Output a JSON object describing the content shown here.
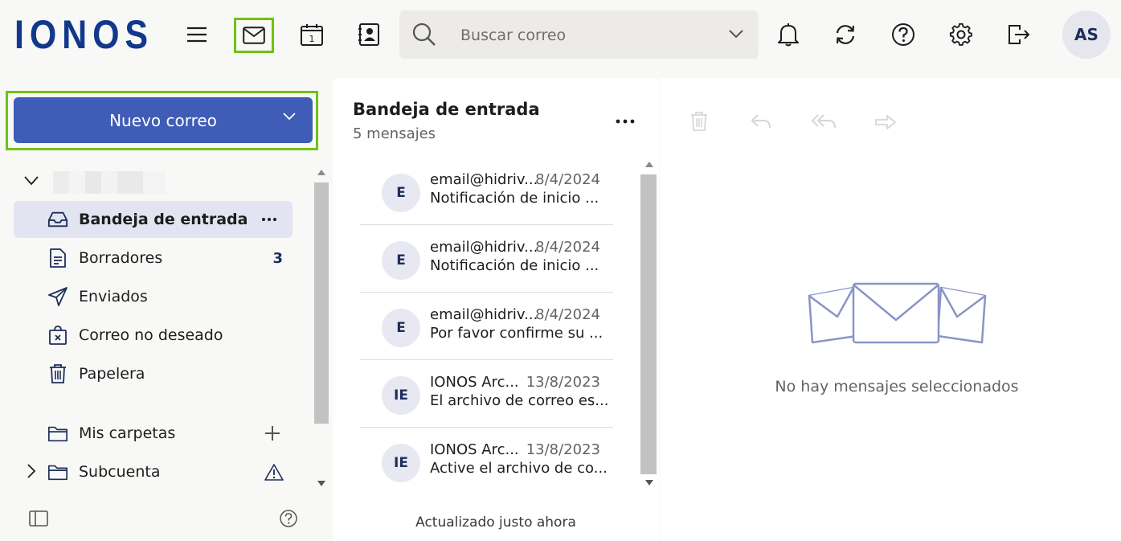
{
  "app": {
    "logo": "IONOS"
  },
  "header": {
    "search_placeholder": "Buscar correo",
    "calendar_day": "1",
    "avatar_initials": "AS"
  },
  "sidebar": {
    "new_mail_label": "Nuevo correo",
    "folders": [
      {
        "label": "Bandeja de entrada",
        "icon": "inbox-icon",
        "count": ""
      },
      {
        "label": "Borradores",
        "icon": "draft-icon",
        "count": "3"
      },
      {
        "label": "Enviados",
        "icon": "send-icon",
        "count": ""
      },
      {
        "label": "Correo no deseado",
        "icon": "spam-icon",
        "count": ""
      },
      {
        "label": "Papelera",
        "icon": "trash-icon",
        "count": ""
      }
    ],
    "my_folders_label": "Mis carpetas",
    "subaccount_label": "Subcuenta"
  },
  "message_list": {
    "title": "Bandeja de entrada",
    "subtitle": "5 mensajes",
    "messages": [
      {
        "initials": "E",
        "from": "email@hidriv...",
        "date": "8/4/2024",
        "subject": "Notificación de inicio ..."
      },
      {
        "initials": "E",
        "from": "email@hidriv...",
        "date": "8/4/2024",
        "subject": "Notificación de inicio ..."
      },
      {
        "initials": "E",
        "from": "email@hidriv...",
        "date": "8/4/2024",
        "subject": "Por favor confirme su ..."
      },
      {
        "initials": "IE",
        "from": "IONOS Arc...",
        "date": "13/8/2023",
        "subject": "El archivo de correo es..."
      },
      {
        "initials": "IE",
        "from": "IONOS Arc...",
        "date": "13/8/2023",
        "subject": "Active el archivo de co..."
      }
    ],
    "updated_text": "Actualizado justo ahora"
  },
  "reading_pane": {
    "empty_text": "No hay mensajes seleccionados"
  },
  "colors": {
    "brand": "#11388c",
    "primary_button": "#3f5cb7",
    "highlight_outline": "#6fc30f",
    "active_folder_bg": "#e2e5f1"
  }
}
